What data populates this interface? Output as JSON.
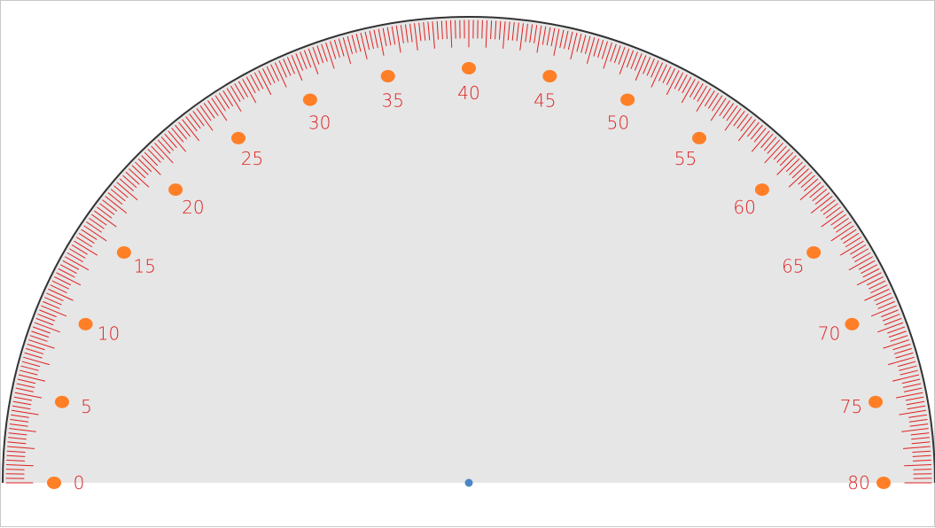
{
  "protractor": {
    "scale_min": 0,
    "scale_max": 80,
    "labels": [
      "0",
      "5",
      "10",
      "15",
      "20",
      "25",
      "30",
      "35",
      "40",
      "45",
      "50",
      "55",
      "60",
      "65",
      "70",
      "75",
      "80"
    ],
    "colors": {
      "face": "#e6e6e6",
      "rim": "#333333",
      "ticks": "#e02020",
      "labels": "#e02020",
      "markers": "#ff7f27",
      "center_dot": "#4a86c5"
    }
  }
}
